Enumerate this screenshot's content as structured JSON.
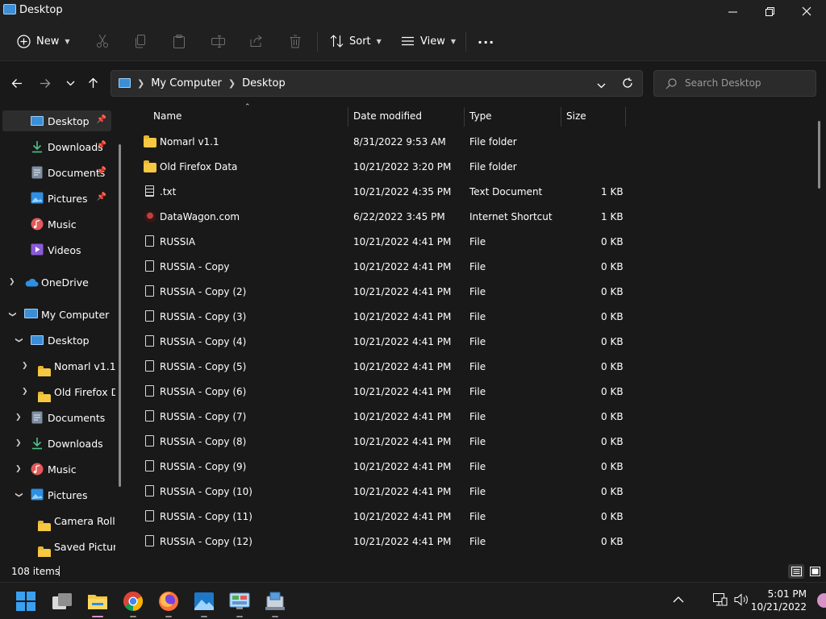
{
  "window": {
    "title": "Desktop"
  },
  "toolbar": {
    "new_label": "New",
    "sort_label": "Sort",
    "view_label": "View",
    "more_label": "..."
  },
  "address": {
    "crumbs": [
      "My Computer",
      "Desktop"
    ]
  },
  "search": {
    "placeholder": "Search Desktop"
  },
  "sidebar": {
    "quick_access": [
      {
        "label": "Desktop",
        "pinned": true
      },
      {
        "label": "Downloads",
        "pinned": true
      },
      {
        "label": "Documents",
        "pinned": true
      },
      {
        "label": "Pictures",
        "pinned": true
      },
      {
        "label": "Music",
        "pinned": false
      },
      {
        "label": "Videos",
        "pinned": false
      }
    ],
    "onedrive": "OneDrive",
    "my_computer": "My Computer",
    "tree": [
      "Desktop",
      "Nomarl v1.1",
      "Old Firefox Da",
      "Documents",
      "Downloads",
      "Music",
      "Pictures",
      "Camera Roll",
      "Saved Picture"
    ]
  },
  "columns": {
    "name": "Name",
    "date": "Date modified",
    "type": "Type",
    "size": "Size"
  },
  "files": [
    {
      "name": "Nomarl v1.1",
      "date": "8/31/2022 9:53 AM",
      "type": "File folder",
      "size": "",
      "icon": "folder-icon"
    },
    {
      "name": "Old Firefox Data",
      "date": "10/21/2022 3:20 PM",
      "type": "File folder",
      "size": "",
      "icon": "folder-icon"
    },
    {
      "name": ".txt",
      "date": "10/21/2022 4:35 PM",
      "type": "Text Document",
      "size": "1 KB",
      "icon": "text-file-icon"
    },
    {
      "name": "DataWagon.com",
      "date": "6/22/2022 3:45 PM",
      "type": "Internet Shortcut",
      "size": "1 KB",
      "icon": "shortcut-icon"
    },
    {
      "name": "RUSSIA",
      "date": "10/21/2022 4:41 PM",
      "type": "File",
      "size": "0 KB",
      "icon": "file-icon"
    },
    {
      "name": "RUSSIA - Copy",
      "date": "10/21/2022 4:41 PM",
      "type": "File",
      "size": "0 KB",
      "icon": "file-icon"
    },
    {
      "name": "RUSSIA - Copy (2)",
      "date": "10/21/2022 4:41 PM",
      "type": "File",
      "size": "0 KB",
      "icon": "file-icon"
    },
    {
      "name": "RUSSIA - Copy (3)",
      "date": "10/21/2022 4:41 PM",
      "type": "File",
      "size": "0 KB",
      "icon": "file-icon"
    },
    {
      "name": "RUSSIA - Copy (4)",
      "date": "10/21/2022 4:41 PM",
      "type": "File",
      "size": "0 KB",
      "icon": "file-icon"
    },
    {
      "name": "RUSSIA - Copy (5)",
      "date": "10/21/2022 4:41 PM",
      "type": "File",
      "size": "0 KB",
      "icon": "file-icon"
    },
    {
      "name": "RUSSIA - Copy (6)",
      "date": "10/21/2022 4:41 PM",
      "type": "File",
      "size": "0 KB",
      "icon": "file-icon"
    },
    {
      "name": "RUSSIA - Copy (7)",
      "date": "10/21/2022 4:41 PM",
      "type": "File",
      "size": "0 KB",
      "icon": "file-icon"
    },
    {
      "name": "RUSSIA - Copy (8)",
      "date": "10/21/2022 4:41 PM",
      "type": "File",
      "size": "0 KB",
      "icon": "file-icon"
    },
    {
      "name": "RUSSIA - Copy (9)",
      "date": "10/21/2022 4:41 PM",
      "type": "File",
      "size": "0 KB",
      "icon": "file-icon"
    },
    {
      "name": "RUSSIA - Copy (10)",
      "date": "10/21/2022 4:41 PM",
      "type": "File",
      "size": "0 KB",
      "icon": "file-icon"
    },
    {
      "name": "RUSSIA - Copy (11)",
      "date": "10/21/2022 4:41 PM",
      "type": "File",
      "size": "0 KB",
      "icon": "file-icon"
    },
    {
      "name": "RUSSIA - Copy (12)",
      "date": "10/21/2022 4:41 PM",
      "type": "File",
      "size": "0 KB",
      "icon": "file-icon"
    }
  ],
  "status": {
    "item_count": "108 items"
  },
  "taskbar": {
    "apps": [
      "start-icon",
      "task-view-icon",
      "file-explorer-icon",
      "chrome-icon",
      "firefox-icon",
      "photos-icon",
      "control-panel-icon",
      "network-app-icon"
    ],
    "time": "5:01 PM",
    "date": "10/21/2022"
  },
  "colors": {
    "background": "#191919",
    "chrome": "#202020",
    "selected": "#2d2d2d",
    "folder": "#f4c842",
    "accent": "#3a8fd6"
  }
}
